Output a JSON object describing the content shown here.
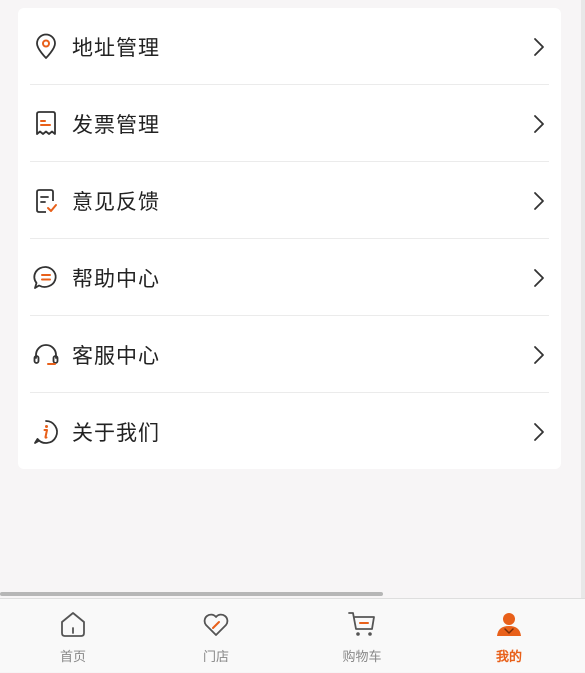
{
  "menu": {
    "items": [
      {
        "label": "地址管理",
        "icon": "location-pin-icon"
      },
      {
        "label": "发票管理",
        "icon": "invoice-icon"
      },
      {
        "label": "意见反馈",
        "icon": "feedback-icon"
      },
      {
        "label": "帮助中心",
        "icon": "help-chat-icon"
      },
      {
        "label": "客服中心",
        "icon": "headset-icon"
      },
      {
        "label": "关于我们",
        "icon": "info-icon"
      }
    ]
  },
  "tabbar": {
    "tabs": [
      {
        "label": "首页",
        "icon": "home-icon",
        "active": false
      },
      {
        "label": "门店",
        "icon": "store-heart-icon",
        "active": false
      },
      {
        "label": "购物车",
        "icon": "cart-icon",
        "active": false
      },
      {
        "label": "我的",
        "icon": "user-icon",
        "active": true
      }
    ]
  },
  "colors": {
    "accent": "#e8601a",
    "text": "#222222",
    "muted": "#888888",
    "background": "#f7f5f6"
  }
}
